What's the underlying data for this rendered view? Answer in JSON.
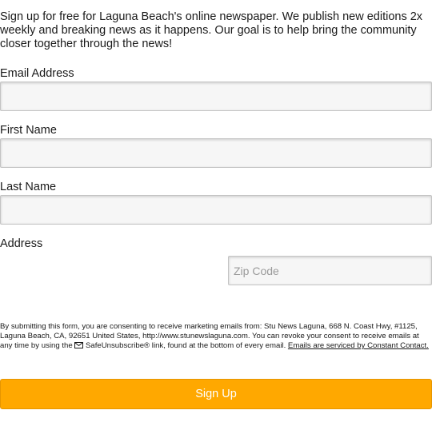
{
  "intro": "Sign up for free for Laguna Beach's online newspaper. We publish new editions 2x weekly and breaking news as it happens. Our goal is to help bring the community closer together through the news!",
  "form": {
    "email": {
      "label": "Email Address",
      "value": "",
      "placeholder": ""
    },
    "first_name": {
      "label": "First Name",
      "value": "",
      "placeholder": ""
    },
    "last_name": {
      "label": "Last Name",
      "value": "",
      "placeholder": ""
    },
    "address": {
      "label": "Address"
    },
    "zip": {
      "value": "",
      "placeholder": "Zip Code"
    }
  },
  "legal": {
    "text_before_icon": "By submitting this form, you are consenting to receive marketing emails from: Stu News Laguna, 668 N. Coast Hwy, #1125, Laguna Beach, CA, 92651 United States, http://www.stunewslaguna.com. You can revoke your consent to receive emails at any time by using the ",
    "safeunsubscribe": "SafeUnsubscribe®",
    "text_after": " link, found at the bottom of every email. ",
    "link_text": "Emails are serviced by Constant Contact.",
    "icon": "envelope-icon"
  },
  "submit_label": "Sign Up",
  "colors": {
    "button_bg": "#ffa800",
    "button_text": "#ffffff",
    "field_bg": "#f6f6f6"
  }
}
